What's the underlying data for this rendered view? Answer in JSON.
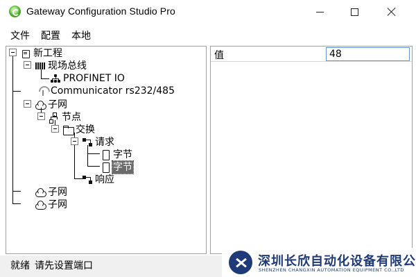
{
  "window": {
    "title": "Gateway Configuration Studio Pro"
  },
  "menu": {
    "items": [
      "文件",
      "配置",
      "本地"
    ]
  },
  "tree": {
    "project": "新工程",
    "fieldbus": "现场总线",
    "profinet": "PROFINET IO",
    "communicator": "Communicator rs232/485",
    "subnet1": "子网",
    "node": "节点",
    "exchange": "交换",
    "request": "请求",
    "byte1": "字节",
    "byte2": "字节",
    "response": "响应",
    "subnet2": "子网",
    "subnet3": "子网"
  },
  "properties": {
    "key": "值",
    "value": "48"
  },
  "status": {
    "ready": "就绪",
    "message": "请先设置端口"
  },
  "watermark": {
    "company_cn": "深圳长欣自动化设备有限公司",
    "company_en": "SHENZHEN CHANGXIN AUTOMATION EQUIPMENT CO.,LTD"
  },
  "colors": {
    "selection": "#6b6b6b",
    "input_border": "#5c9bd6",
    "brand": "#1e3a78"
  }
}
